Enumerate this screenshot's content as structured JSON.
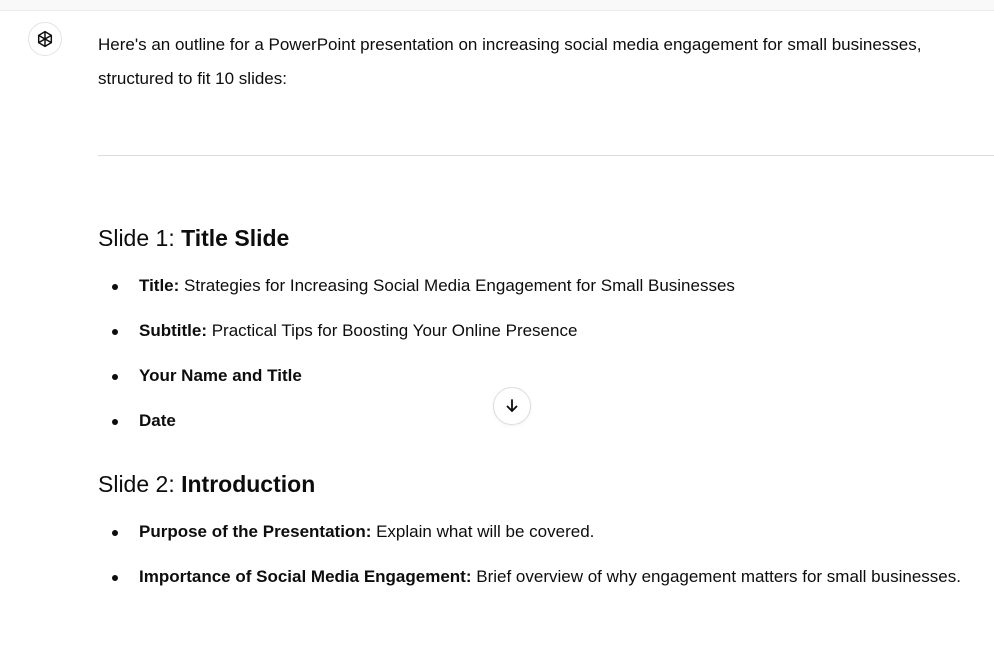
{
  "assistant": {
    "avatar_icon": "openai-logo-icon"
  },
  "message": {
    "intro": "Here's an outline for a PowerPoint presentation on increasing social media engagement for small businesses, structured to fit 10 slides:",
    "slides": [
      {
        "heading_prefix": "Slide 1: ",
        "heading_bold": "Title Slide",
        "bullets": [
          {
            "label": "Title:",
            "text": " Strategies for Increasing Social Media Engagement for Small Businesses"
          },
          {
            "label": "Subtitle:",
            "text": " Practical Tips for Boosting Your Online Presence"
          },
          {
            "label": "Your Name and Title",
            "text": ""
          },
          {
            "label": "Date",
            "text": ""
          }
        ]
      },
      {
        "heading_prefix": "Slide 2: ",
        "heading_bold": "Introduction",
        "bullets": [
          {
            "label": "Purpose of the Presentation:",
            "text": " Explain what will be covered."
          },
          {
            "label": "Importance of Social Media Engagement:",
            "text": " Brief overview of why engagement matters for small businesses."
          }
        ]
      }
    ]
  },
  "scroll_button": {
    "icon": "arrow-down-icon"
  }
}
